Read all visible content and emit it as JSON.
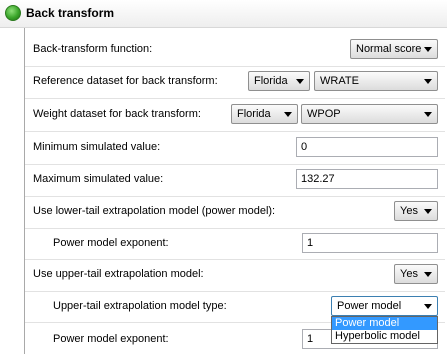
{
  "header": {
    "title": "Back transform"
  },
  "rows": {
    "backtransform_function": {
      "label": "Back-transform function:",
      "value": "Normal score"
    },
    "reference_dataset": {
      "label": "Reference dataset for back transform:",
      "dataset": "Florida",
      "field": "WRATE"
    },
    "weight_dataset": {
      "label": "Weight dataset for back transform:",
      "dataset": "Florida",
      "field": "WPOP"
    },
    "min_simulated": {
      "label": "Minimum simulated value:",
      "value": "0"
    },
    "max_simulated": {
      "label": "Maximum simulated value:",
      "value": "132.27"
    },
    "lower_tail": {
      "label": "Use lower-tail extrapolation model (power model):",
      "value": "Yes"
    },
    "lower_power_exponent": {
      "label": "Power model exponent:",
      "value": "1"
    },
    "upper_tail": {
      "label": "Use upper-tail extrapolation model:",
      "value": "Yes"
    },
    "upper_model_type": {
      "label": "Upper-tail extrapolation model type:",
      "value": "Power model"
    },
    "upper_power_exponent": {
      "label": "Power model exponent:",
      "value": "1"
    }
  },
  "dropdown": {
    "options": [
      "Power model",
      "Hyperbolic model"
    ],
    "selected_index": 0
  }
}
